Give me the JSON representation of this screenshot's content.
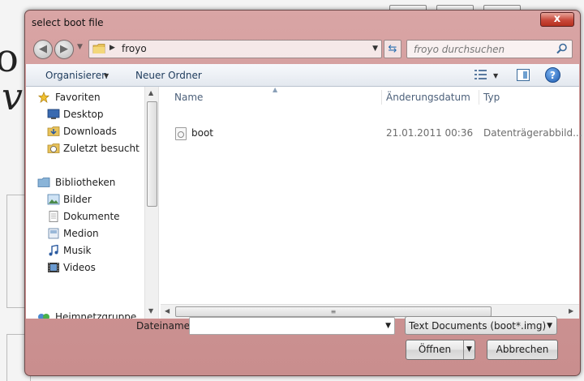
{
  "dialog": {
    "title": "select boot file",
    "close_label": "x"
  },
  "address_bar": {
    "current_folder": "froyo",
    "search_placeholder": "froyo durchsuchen"
  },
  "toolbar": {
    "organize_label": "Organisieren",
    "new_folder_label": "Neuer Ordner"
  },
  "nav_pane": {
    "favorites_label": "Favoriten",
    "favorites": [
      {
        "label": "Desktop",
        "icon": "desktop-icon"
      },
      {
        "label": "Downloads",
        "icon": "downloads-icon"
      },
      {
        "label": "Zuletzt besucht",
        "icon": "recent-places-icon"
      }
    ],
    "libraries_label": "Bibliotheken",
    "libraries": [
      {
        "label": "Bilder",
        "icon": "pictures-icon"
      },
      {
        "label": "Dokumente",
        "icon": "documents-icon"
      },
      {
        "label": "Medion",
        "icon": "library-icon"
      },
      {
        "label": "Musik",
        "icon": "music-icon"
      },
      {
        "label": "Videos",
        "icon": "videos-icon"
      }
    ],
    "homegroup_label": "Heimnetzgruppe"
  },
  "file_list": {
    "columns": [
      "Name",
      "Änderungsdatum",
      "Typ"
    ],
    "rows": [
      {
        "name": "boot",
        "modified": "21.01.2011 00:36",
        "type": "Datenträgerabbild..."
      }
    ]
  },
  "footer": {
    "filename_label": "Dateiname:",
    "filename_value": "",
    "filetype_selected": "Text Documents (boot*.img)",
    "open_label": "Öffnen",
    "cancel_label": "Abbrechen"
  },
  "colors": {
    "frame": "#cf9696",
    "toolbar": "#e3e8ef",
    "link_text": "#1e3b5c"
  }
}
